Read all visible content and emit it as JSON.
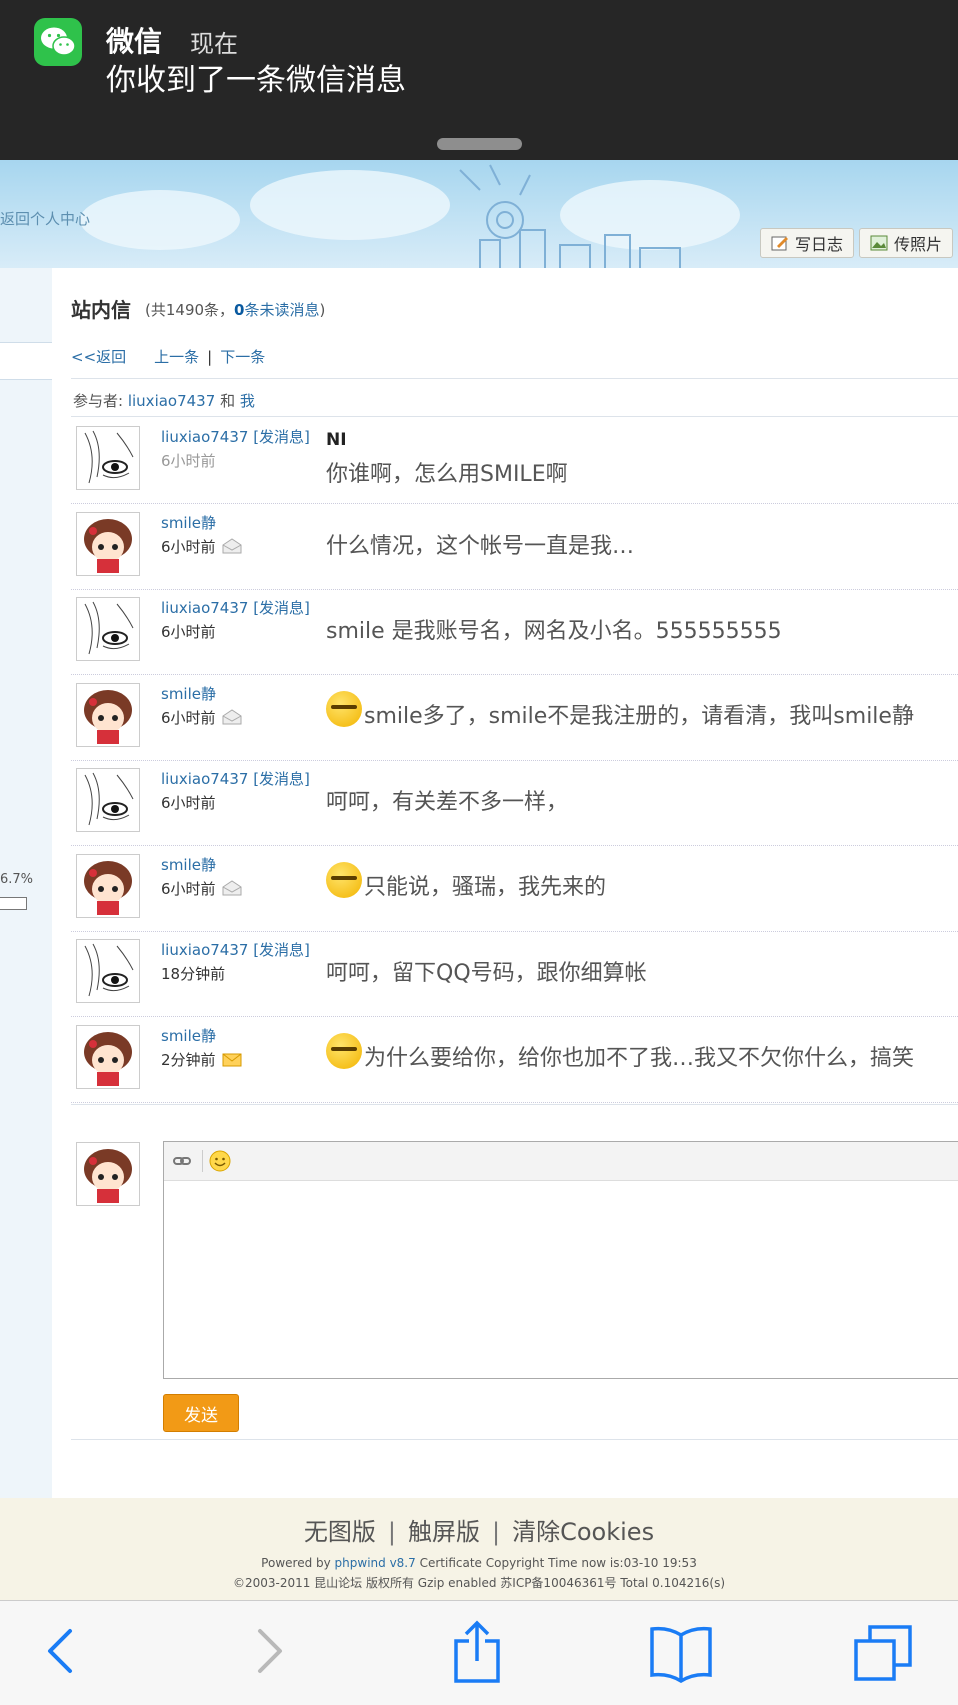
{
  "notification": {
    "app": "微信",
    "time": "现在",
    "message": "你收到了一条微信消息"
  },
  "banner": {
    "back_link": "返回个人中心",
    "write_blog": "写日志",
    "upload_photo": "传照片"
  },
  "sidebar": {
    "percent": "6.7%"
  },
  "inbox": {
    "title": "站内信",
    "count_prefix": "(共1490条，",
    "unread_count": "0",
    "unread_label": "条未读消息",
    "count_suffix": ")"
  },
  "nav": {
    "back": "<<返回",
    "prev": "上一条",
    "sep": "|",
    "next": "下一条"
  },
  "participants": {
    "label": "参与者:",
    "user": "liuxiao7437",
    "and": "和",
    "me": "我"
  },
  "messages": [
    {
      "name": "liuxiao7437 [发消息]",
      "time": "6小时前",
      "title": "NI",
      "text": "你谁啊，怎么用SMILE啊"
    },
    {
      "name": "smile静",
      "time": "6小时前",
      "text": "什么情况，这个帐号一直是我…"
    },
    {
      "name": "liuxiao7437 [发消息]",
      "time": "6小时前",
      "text": "smile  是我账号名，网名及小名。555555555"
    },
    {
      "name": "smile静",
      "time": "6小时前",
      "text": "smile多了，smile不是我注册的，请看清，我叫smile静"
    },
    {
      "name": "liuxiao7437 [发消息]",
      "time": "6小时前",
      "text": "呵呵，有关差不多一样，"
    },
    {
      "name": "smile静",
      "time": "6小时前",
      "text": "只能说，骚瑞，我先来的"
    },
    {
      "name": "liuxiao7437 [发消息]",
      "time": "18分钟前",
      "text": "呵呵，留下QQ号码，跟你细算帐"
    },
    {
      "name": "smile静",
      "time": "2分钟前",
      "text": "为什么要给你，给你也加不了我…我又不欠你什么，搞笑"
    }
  ],
  "reply": {
    "send": "发送"
  },
  "footer": {
    "link1": "无图版",
    "link2": "触屏版",
    "link3": "清除Cookies",
    "sep": "|",
    "powered_prefix": "Powered by ",
    "powered_link": "phpwind v8.7",
    "powered_suffix": " Certificate Copyright Time now is:03-10 19:53",
    "copyright": "©2003-2011 昆山论坛 版权所有 Gzip enabled 苏ICP备10046361号 Total 0.104216(s)"
  },
  "colors": {
    "link": "#2b6ea6",
    "send_button": "#f29a16",
    "wechat": "#2fc24b",
    "safari_blue": "#1a7cf5"
  }
}
